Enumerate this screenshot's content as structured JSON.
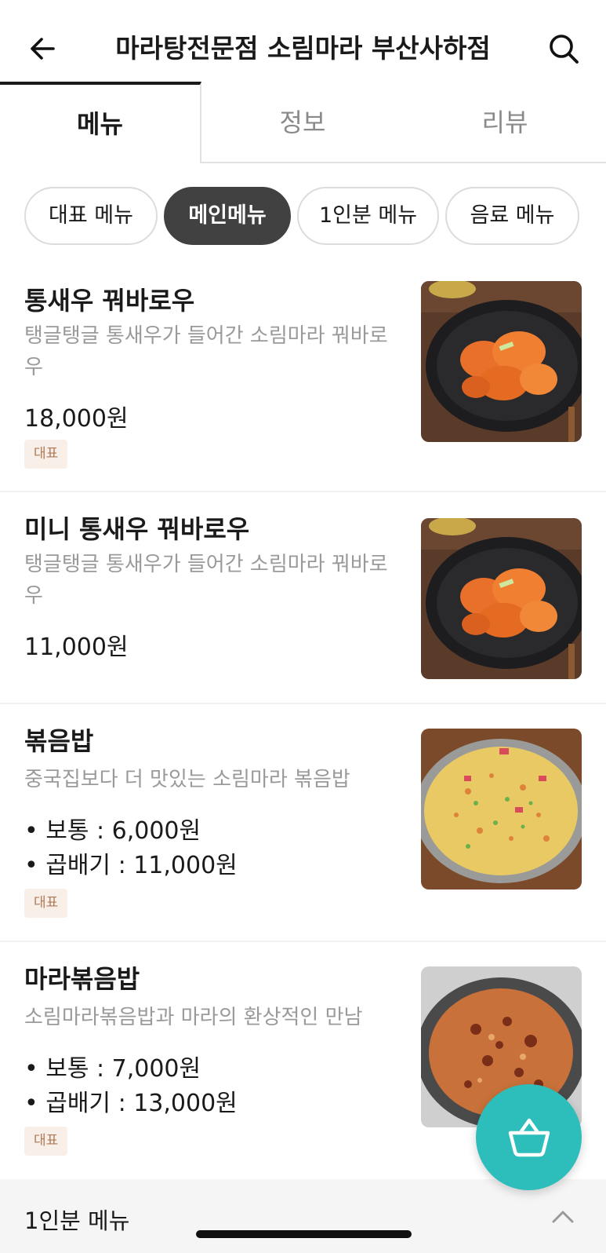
{
  "header": {
    "title": "마라탕전문점 소림마라 부산사하점"
  },
  "tabs": [
    {
      "label": "메뉴"
    },
    {
      "label": "정보"
    },
    {
      "label": "리뷰"
    }
  ],
  "chips": [
    {
      "label": "대표 메뉴",
      "active": false
    },
    {
      "label": "메인메뉴",
      "active": true
    },
    {
      "label": "1인분 메뉴",
      "active": false
    },
    {
      "label": "음료 메뉴",
      "active": false
    }
  ],
  "items": [
    {
      "name": "통새우 꿔바로우",
      "desc_line1": "탱글탱글 통새우가 들어간 소림마라 꿔바로",
      "desc_line2": "우",
      "price": "18,000원",
      "badge": "대표"
    },
    {
      "name": "미니 통새우 꿔바로우",
      "desc_line1": "탱글탱글 통새우가 들어간 소림마라 꿔바로",
      "desc_line2": "우",
      "price": "11,000원"
    },
    {
      "name": "볶음밥",
      "desc_line1": "중국집보다 더 맛있는 소림마라 볶음밥",
      "option1": "• 보통 : 6,000원",
      "option2": "• 곱배기 : 11,000원",
      "badge": "대표"
    },
    {
      "name": "마라볶음밥",
      "desc_line1": "소림마라볶음밥과 마라의 환상적인 만남",
      "option1": "• 보통 : 7,000원",
      "option2": "• 곱배기 : 13,000원",
      "badge": "대표"
    }
  ],
  "section": {
    "title": "1인분 메뉴"
  },
  "icons": {
    "back": "back-arrow-icon",
    "search": "search-icon",
    "cart": "basket-icon",
    "collapse": "chevron-up-icon"
  },
  "colors": {
    "accent": "#2dbdbb",
    "active_chip": "#414141",
    "badge_text": "#b07a56",
    "badge_bg": "#f7efe8"
  }
}
